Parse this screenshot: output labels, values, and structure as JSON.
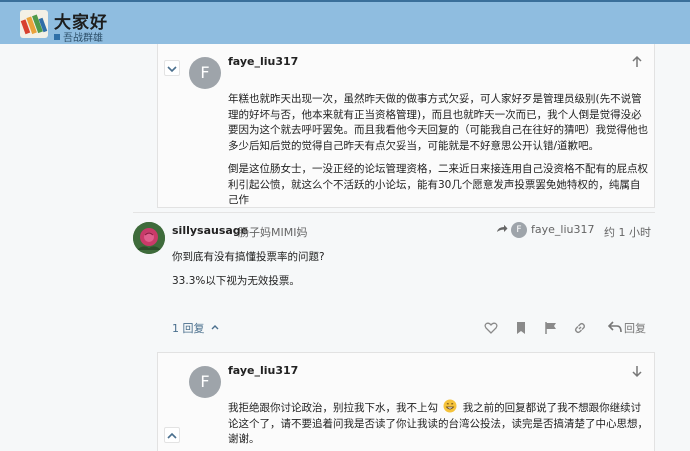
{
  "header": {
    "title": "大家好",
    "subtitle": "吾战群雄"
  },
  "quote_top": {
    "username": "faye_liu317",
    "avatar_letter": "F",
    "paragraphs": [
      "年糕也就昨天出现一次，虽然昨天做的做事方式欠妥，可人家好歹是管理员级别(先不说管理的好坏与否，他本来就有正当资格管理)，而且也就昨天一次而已，我个人倒是觉得没必要因为这个就去呼吁罢免。而且我看他今天回复的（可能我自己在往好的猜吧）我觉得他也多少后知后觉的觉得自己昨天有点欠妥当，可能就是不好意思公开认错/道歉吧。",
      "倒是这位肠女士，一没正经的论坛管理资格，二来近日来接连用自己没资格不配有的屁点权利引起公愤，就这么个不活跃的小论坛，能有30几个愿意发声投票罢免她特权的，纯属自己作"
    ]
  },
  "main_post": {
    "username": "sillysausage",
    "user_title": "肠子妈MIMI妈",
    "reply_to_letter": "F",
    "reply_to_user": "faye_liu317",
    "date": "约 1 小时",
    "paragraphs": [
      "你到底有没有搞懂投票率的问题?",
      "33.3%以下视为无效投票。"
    ],
    "replies_label": "1 回复",
    "reply_label": "回复"
  },
  "quote_bottom": {
    "username": "faye_liu317",
    "avatar_letter": "F",
    "text_before_emoji": "我拒绝跟你讨论政治，别拉我下水，我不上勾",
    "text_after_emoji": "我之前的回复都说了我不想跟你继续讨论这个了，请不要追着问我是否读了你让我读的台湾公投法，读完是否搞清楚了中心思想，谢谢。"
  },
  "colors": {
    "header_bg": "#8fbde0",
    "link": "#4a6f8d"
  }
}
